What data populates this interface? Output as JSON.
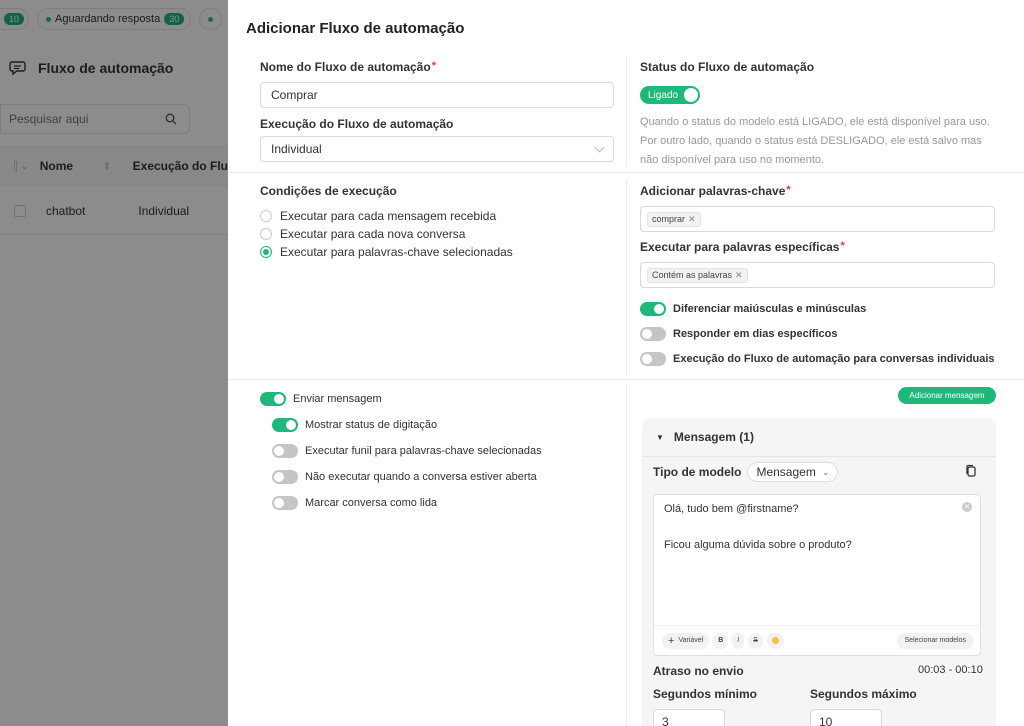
{
  "background": {
    "statuses": [
      {
        "label": "",
        "count": "10"
      },
      {
        "label": "Aguardando resposta",
        "count": "30"
      }
    ],
    "page_title": "Fluxo de automação",
    "search_placeholder": "Pesquisar aqui",
    "table": {
      "headers": [
        "Nome",
        "Execução do Flu"
      ],
      "rows": [
        {
          "name": "chatbot",
          "execution": "Individual"
        }
      ]
    }
  },
  "modal": {
    "title": "Adicionar Fluxo de automação",
    "name_label": "Nome do Fluxo de automação",
    "name_value": "Comprar",
    "execution_label": "Execução do Fluxo de automação",
    "execution_value": "Individual",
    "status_label": "Status do Fluxo de automação",
    "status_toggle_label": "Ligado",
    "status_on": true,
    "status_desc_1": "Quando o status do modelo está LIGADO, ele está disponível para uso.",
    "status_desc_2": "Por outro lado, quando o status está DESLIGADO, ele está salvo mas",
    "status_desc_3": "não disponível para uso no momento.",
    "conditions_label": "Condições de execução",
    "conditions": [
      {
        "label": "Executar para cada mensagem recebida",
        "checked": false
      },
      {
        "label": "Executar para cada nova conversa",
        "checked": false
      },
      {
        "label": "Executar para palavras-chave selecionadas",
        "checked": true
      }
    ],
    "keywords_label": "Adicionar palavras-chave",
    "keywords": [
      "comprar"
    ],
    "specific_label": "Executar para palavras específicas",
    "specific_tags": [
      "Contém as palavras"
    ],
    "right_toggles": [
      {
        "label": "Diferenciar maiúsculas e minúsculas",
        "on": true
      },
      {
        "label": "Responder em dias específicos",
        "on": false
      },
      {
        "label": "Execução do Fluxo de automação para conversas individuais",
        "on": false
      }
    ],
    "send_message_label": "Enviar mensagem",
    "send_message_on": true,
    "left_toggles": [
      {
        "label": "Mostrar status de digitação",
        "on": true
      },
      {
        "label": "Executar funil para palavras-chave selecionadas",
        "on": false
      },
      {
        "label": "Não executar quando a conversa estiver aberta",
        "on": false
      },
      {
        "label": "Marcar conversa como lida",
        "on": false
      }
    ],
    "add_message_button": "Adicionar mensagem",
    "message_card": {
      "header": "Mensagem (1)",
      "model_type_label": "Tipo de modelo",
      "model_type_value": "Mensagem",
      "text_line_1": "Olá, tudo bem @firstname?",
      "text_line_2": "Ficou alguma dúvida sobre o produto?",
      "toolbar": {
        "variable": "Variável",
        "bold": "B",
        "italic": "I",
        "strike": "S",
        "select_models": "Selecionar modelos"
      },
      "delay_label": "Atraso no envio",
      "delay_value": "00:03 - 00:10",
      "min_label": "Segundos mínimo",
      "min_value": "3",
      "max_label": "Segundos máximo",
      "max_value": "10"
    }
  },
  "colors": {
    "accent": "#1db87a",
    "required": "#e53935"
  }
}
